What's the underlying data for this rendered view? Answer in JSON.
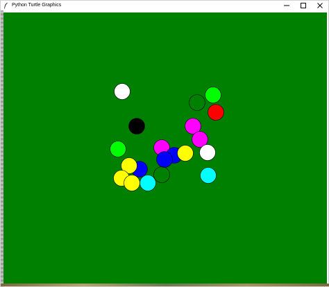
{
  "window": {
    "title": "Python Turtle Graphics",
    "icon": "feather-icon"
  },
  "controls": {
    "minimize": "minimize-icon",
    "maximize": "maximize-icon",
    "close": "close-icon"
  },
  "canvas": {
    "background": "#008000"
  },
  "balls": [
    {
      "color": "#ffffff",
      "filled": true
    },
    {
      "color": "#00ff00",
      "filled": true
    },
    {
      "color": "#000000",
      "filled": false
    },
    {
      "color": "#ff0000",
      "filled": true
    },
    {
      "color": "#000000",
      "filled": true
    },
    {
      "color": "#ff00ff",
      "filled": true
    },
    {
      "color": "#ff00ff",
      "filled": true
    },
    {
      "color": "#00ff00",
      "filled": true
    },
    {
      "color": "#ff00ff",
      "filled": true
    },
    {
      "color": "#0000ff",
      "filled": true
    },
    {
      "color": "#0000ff",
      "filled": true
    },
    {
      "color": "#ffff00",
      "filled": true
    },
    {
      "color": "#ffffff",
      "filled": true
    },
    {
      "color": "#0000ff",
      "filled": true
    },
    {
      "color": "#ffff00",
      "filled": true
    },
    {
      "color": "#000000",
      "filled": false
    },
    {
      "color": "#ffff00",
      "filled": true
    },
    {
      "color": "#ffff00",
      "filled": true
    },
    {
      "color": "#00ffff",
      "filled": true
    },
    {
      "color": "#00ffff",
      "filled": true
    }
  ]
}
